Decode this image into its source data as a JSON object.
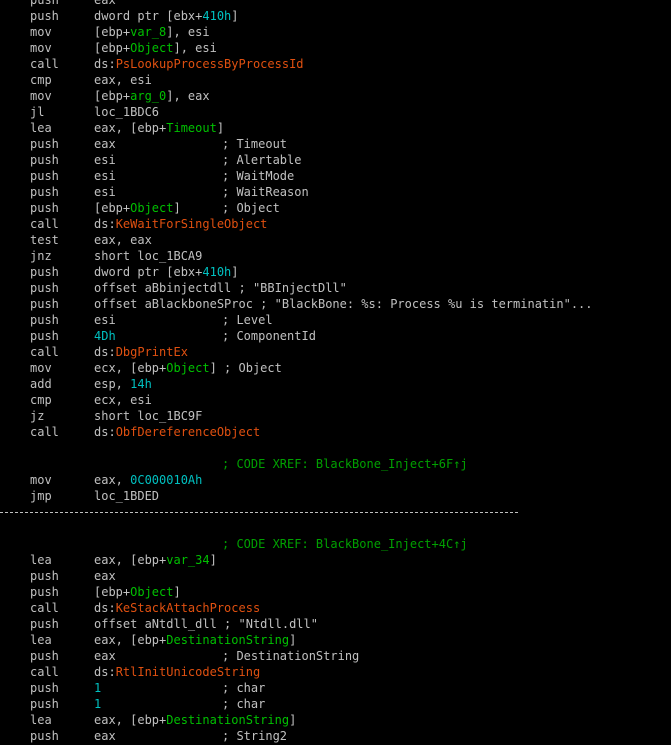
{
  "colors": {
    "background": "#000000",
    "text": "#c0c0c0",
    "number": "#00c0c0",
    "variable": "#00c000",
    "import": "#e05010",
    "xref_comment": "#00a000"
  },
  "lines": [
    {
      "mn": "push",
      "ops": [
        {
          "t": "eax",
          "c": "reg"
        }
      ]
    },
    {
      "mn": "push",
      "ops": [
        {
          "t": "dword ptr [ebx+",
          "c": "txt"
        },
        {
          "t": "410h",
          "c": "num"
        },
        {
          "t": "]",
          "c": "txt"
        }
      ]
    },
    {
      "mn": "mov",
      "ops": [
        {
          "t": "[ebp+",
          "c": "txt"
        },
        {
          "t": "var_8",
          "c": "var"
        },
        {
          "t": "], esi",
          "c": "txt"
        }
      ]
    },
    {
      "mn": "mov",
      "ops": [
        {
          "t": "[ebp+",
          "c": "txt"
        },
        {
          "t": "Object",
          "c": "var"
        },
        {
          "t": "], esi",
          "c": "txt"
        }
      ]
    },
    {
      "mn": "call",
      "ops": [
        {
          "t": "ds:",
          "c": "txt"
        },
        {
          "t": "PsLookupProcessByProcessId",
          "c": "imp"
        }
      ]
    },
    {
      "mn": "cmp",
      "ops": [
        {
          "t": "eax, esi",
          "c": "txt"
        }
      ]
    },
    {
      "mn": "mov",
      "ops": [
        {
          "t": "[ebp+",
          "c": "txt"
        },
        {
          "t": "arg_0",
          "c": "var"
        },
        {
          "t": "], eax",
          "c": "txt"
        }
      ]
    },
    {
      "mn": "jl",
      "ops": [
        {
          "t": "loc_1BDC6",
          "c": "txt"
        }
      ]
    },
    {
      "mn": "lea",
      "ops": [
        {
          "t": "eax, [ebp+",
          "c": "txt"
        },
        {
          "t": "Timeout",
          "c": "var"
        },
        {
          "t": "]",
          "c": "txt"
        }
      ]
    },
    {
      "mn": "push",
      "ops": [
        {
          "t": "eax",
          "c": "txt"
        }
      ],
      "cmt": "; Timeout"
    },
    {
      "mn": "push",
      "ops": [
        {
          "t": "esi",
          "c": "txt"
        }
      ],
      "cmt": "; Alertable"
    },
    {
      "mn": "push",
      "ops": [
        {
          "t": "esi",
          "c": "txt"
        }
      ],
      "cmt": "; WaitMode"
    },
    {
      "mn": "push",
      "ops": [
        {
          "t": "esi",
          "c": "txt"
        }
      ],
      "cmt": "; WaitReason"
    },
    {
      "mn": "push",
      "ops": [
        {
          "t": "[ebp+",
          "c": "txt"
        },
        {
          "t": "Object",
          "c": "var"
        },
        {
          "t": "]",
          "c": "txt"
        }
      ],
      "cmt": "; Object"
    },
    {
      "mn": "call",
      "ops": [
        {
          "t": "ds:",
          "c": "txt"
        },
        {
          "t": "KeWaitForSingleObject",
          "c": "imp"
        }
      ]
    },
    {
      "mn": "test",
      "ops": [
        {
          "t": "eax, eax",
          "c": "txt"
        }
      ]
    },
    {
      "mn": "jnz",
      "ops": [
        {
          "t": "short loc_1BCA9",
          "c": "txt"
        }
      ]
    },
    {
      "mn": "push",
      "ops": [
        {
          "t": "dword ptr [ebx+",
          "c": "txt"
        },
        {
          "t": "410h",
          "c": "num"
        },
        {
          "t": "]",
          "c": "txt"
        }
      ]
    },
    {
      "mn": "push",
      "ops": [
        {
          "t": "offset aBbinjectdll ; \"BBInjectDll\"",
          "c": "txt"
        }
      ]
    },
    {
      "mn": "push",
      "ops": [
        {
          "t": "offset aBlackboneSProc ; \"BlackBone: %s: Process %u is terminatin\"...",
          "c": "txt"
        }
      ]
    },
    {
      "mn": "push",
      "ops": [
        {
          "t": "esi",
          "c": "txt"
        }
      ],
      "cmt": "; Level"
    },
    {
      "mn": "push",
      "ops": [
        {
          "t": "4Dh",
          "c": "num"
        }
      ],
      "cmt": "; ComponentId"
    },
    {
      "mn": "call",
      "ops": [
        {
          "t": "ds:",
          "c": "txt"
        },
        {
          "t": "DbgPrintEx",
          "c": "imp"
        }
      ]
    },
    {
      "mn": "mov",
      "ops": [
        {
          "t": "ecx, [ebp+",
          "c": "txt"
        },
        {
          "t": "Object",
          "c": "var"
        },
        {
          "t": "] ; Object",
          "c": "txt"
        }
      ]
    },
    {
      "mn": "add",
      "ops": [
        {
          "t": "esp, ",
          "c": "txt"
        },
        {
          "t": "14h",
          "c": "num"
        }
      ]
    },
    {
      "mn": "cmp",
      "ops": [
        {
          "t": "ecx, esi",
          "c": "txt"
        }
      ]
    },
    {
      "mn": "jz",
      "ops": [
        {
          "t": "short loc_1BC9F",
          "c": "txt"
        }
      ]
    },
    {
      "mn": "call",
      "ops": [
        {
          "t": "ds:",
          "c": "txt"
        },
        {
          "t": "ObfDereferenceObject",
          "c": "imp"
        }
      ]
    },
    {
      "kind": "blank"
    },
    {
      "kind": "xref",
      "text": "; CODE XREF: BlackBone_Inject+6F↑j"
    },
    {
      "mn": "mov",
      "ops": [
        {
          "t": "eax, ",
          "c": "txt"
        },
        {
          "t": "0C000010Ah",
          "c": "num"
        }
      ]
    },
    {
      "mn": "jmp",
      "ops": [
        {
          "t": "loc_1BDED",
          "c": "txt"
        }
      ]
    },
    {
      "kind": "sep"
    },
    {
      "kind": "blank"
    },
    {
      "kind": "xref",
      "text": "; CODE XREF: BlackBone_Inject+4C↑j"
    },
    {
      "mn": "lea",
      "ops": [
        {
          "t": "eax, [ebp+",
          "c": "txt"
        },
        {
          "t": "var_34",
          "c": "var"
        },
        {
          "t": "]",
          "c": "txt"
        }
      ]
    },
    {
      "mn": "push",
      "ops": [
        {
          "t": "eax",
          "c": "txt"
        }
      ]
    },
    {
      "mn": "push",
      "ops": [
        {
          "t": "[ebp+",
          "c": "txt"
        },
        {
          "t": "Object",
          "c": "var"
        },
        {
          "t": "]",
          "c": "txt"
        }
      ]
    },
    {
      "mn": "call",
      "ops": [
        {
          "t": "ds:",
          "c": "txt"
        },
        {
          "t": "KeStackAttachProcess",
          "c": "imp"
        }
      ]
    },
    {
      "mn": "push",
      "ops": [
        {
          "t": "offset aNtdll_dll ; \"Ntdll.dll\"",
          "c": "txt"
        }
      ]
    },
    {
      "mn": "lea",
      "ops": [
        {
          "t": "eax, [ebp+",
          "c": "txt"
        },
        {
          "t": "DestinationString",
          "c": "var"
        },
        {
          "t": "]",
          "c": "txt"
        }
      ]
    },
    {
      "mn": "push",
      "ops": [
        {
          "t": "eax",
          "c": "txt"
        }
      ],
      "cmt": "; DestinationString"
    },
    {
      "mn": "call",
      "ops": [
        {
          "t": "ds:",
          "c": "txt"
        },
        {
          "t": "RtlInitUnicodeString",
          "c": "imp"
        }
      ]
    },
    {
      "mn": "push",
      "ops": [
        {
          "t": "1",
          "c": "num"
        }
      ],
      "cmt": "; char"
    },
    {
      "mn": "push",
      "ops": [
        {
          "t": "1",
          "c": "num"
        }
      ],
      "cmt": "; char"
    },
    {
      "mn": "lea",
      "ops": [
        {
          "t": "eax, [ebp+",
          "c": "txt"
        },
        {
          "t": "DestinationString",
          "c": "var"
        },
        {
          "t": "]",
          "c": "txt"
        }
      ]
    },
    {
      "mn": "push",
      "ops": [
        {
          "t": "eax",
          "c": "txt"
        }
      ],
      "cmt": "; String2"
    }
  ]
}
